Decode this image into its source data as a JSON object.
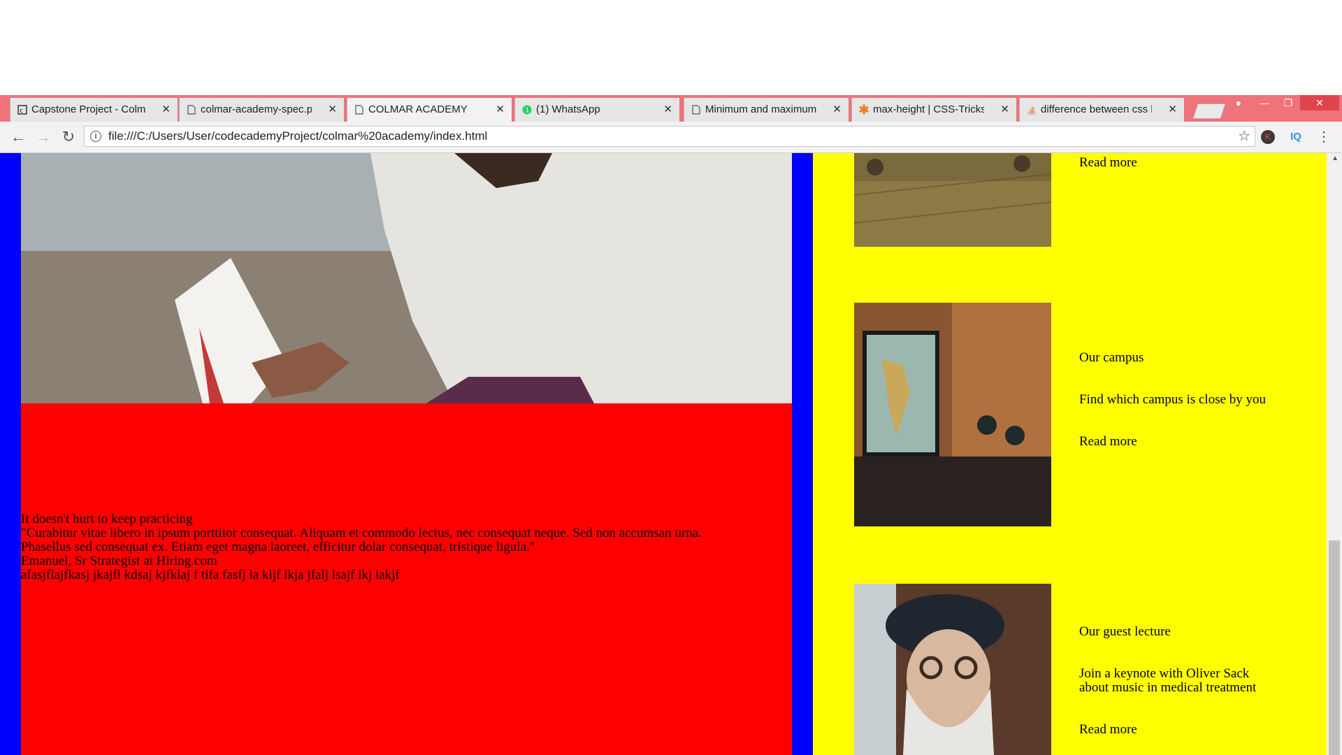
{
  "browser": {
    "tabs": [
      {
        "label": "Capstone Project - Colmar",
        "icon": "codecademy-icon",
        "active": false
      },
      {
        "label": "colmar-academy-spec.png",
        "icon": "file-icon",
        "active": false
      },
      {
        "label": "COLMAR ACADEMY",
        "icon": "file-icon",
        "active": true
      },
      {
        "label": "(1) WhatsApp",
        "icon": "whatsapp-icon",
        "active": false
      },
      {
        "label": "Minimum and maximum",
        "icon": "file-icon",
        "active": false
      },
      {
        "label": "max-height | CSS-Tricks",
        "icon": "csstricks-icon",
        "active": false
      },
      {
        "label": "difference between css he",
        "icon": "stackoverflow-icon",
        "active": false
      }
    ],
    "close_glyph": "✕",
    "url": "file:///C:/Users/User/codecademyProject/colmar%20academy/index.html",
    "colors": {
      "tabstrip": "#f0727a"
    }
  },
  "page": {
    "testimonial": {
      "heading": "It doesn't hurt to keep practicing",
      "quote_line1": "\"Curabitur vitae libero in ipsum porttitor consequat. Aliquam et commodo lectus, nec consequat neque. Sed non accumsan urna.",
      "quote_line2": "Phasellus sed consequat ex. Etiam eget magna laoreet, efficitur dolar consequat, tristique ligula.\"",
      "author": "Emanuel, Sr Strategist at Hiring.com",
      "extra": "afasjflajfkasj jkajfl kdsaj kjfklaj f tifa fasfj la kljf lkja jfalj lsajf lkj lakjf"
    },
    "cards": [
      {
        "read_more": "Read more"
      },
      {
        "title": "Our campus",
        "description": "Find which campus is close by you",
        "read_more": "Read more"
      },
      {
        "title": "Our guest lecture",
        "description_line1": "Join a keynote with Oliver Sack",
        "description_line2": "about music in medical treatment",
        "read_more": "Read more"
      }
    ],
    "colors": {
      "left_bg": "#0000ff",
      "block": "#ff0000",
      "right_bg": "#ffff00"
    }
  }
}
